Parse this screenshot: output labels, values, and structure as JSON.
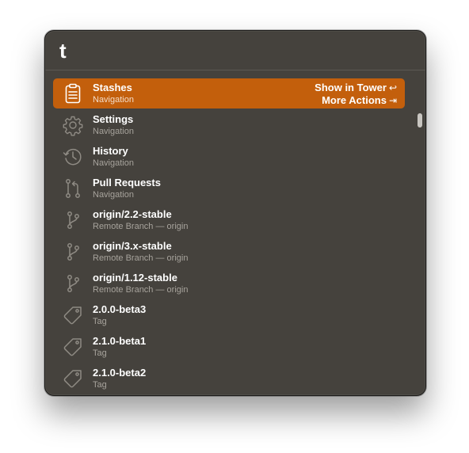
{
  "search": {
    "query": "t"
  },
  "selected_actions": {
    "primary_label": "Show in Tower",
    "primary_key": "↩",
    "secondary_label": "More Actions",
    "secondary_key": "⇥"
  },
  "results": [
    {
      "title": "Stashes",
      "subtitle": "Navigation",
      "icon": "clipboard-icon"
    },
    {
      "title": "Settings",
      "subtitle": "Navigation",
      "icon": "gear-icon"
    },
    {
      "title": "History",
      "subtitle": "Navigation",
      "icon": "clock-history-icon"
    },
    {
      "title": "Pull Requests",
      "subtitle": "Navigation",
      "icon": "pull-request-icon"
    },
    {
      "title": "origin/2.2-stable",
      "subtitle": "Remote Branch — origin",
      "icon": "branch-icon"
    },
    {
      "title": "origin/3.x-stable",
      "subtitle": "Remote Branch — origin",
      "icon": "branch-icon"
    },
    {
      "title": "origin/1.12-stable",
      "subtitle": "Remote Branch — origin",
      "icon": "branch-icon"
    },
    {
      "title": "2.0.0-beta3",
      "subtitle": "Tag",
      "icon": "tag-icon"
    },
    {
      "title": "2.1.0-beta1",
      "subtitle": "Tag",
      "icon": "tag-icon"
    },
    {
      "title": "2.1.0-beta2",
      "subtitle": "Tag",
      "icon": "tag-icon"
    }
  ],
  "colors": {
    "window_bg": "#45423d",
    "selection": "#c35f0c",
    "subtitle": "#a7a39c",
    "icon_stroke": "#8f8b84"
  }
}
